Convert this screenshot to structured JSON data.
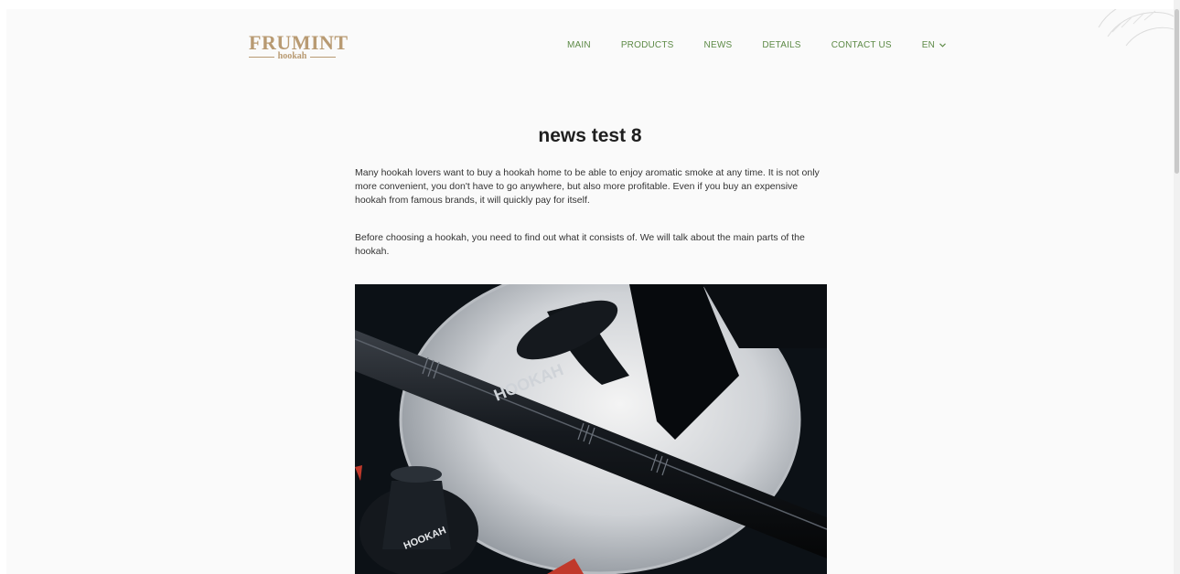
{
  "header": {
    "logo": {
      "word": "FRUMINT",
      "sub": "hookah"
    },
    "nav": [
      {
        "label": "MAIN"
      },
      {
        "label": "PRODUCTS"
      },
      {
        "label": "NEWS"
      },
      {
        "label": "DETAILS"
      },
      {
        "label": "CONTACT US"
      }
    ],
    "language": "EN"
  },
  "article": {
    "title": "news test 8",
    "paragraphs": [
      "Many hookah lovers want to buy a hookah home to be able to enjoy aromatic smoke at any time. It is not only more convenient, you don't have to go anywhere, but also more profitable. Even if you buy an expensive hookah from famous brands, it will quickly pay for itself.",
      "Before choosing a hookah, you need to find out what it consists of. We will talk about the main parts of the hookah."
    ],
    "image_text": [
      "HOOKAH",
      "HOOKAH"
    ]
  },
  "colors": {
    "brand_gold": "#b89a72",
    "nav_green": "#5d8a46",
    "background": "#fafafa",
    "text": "#333333"
  }
}
